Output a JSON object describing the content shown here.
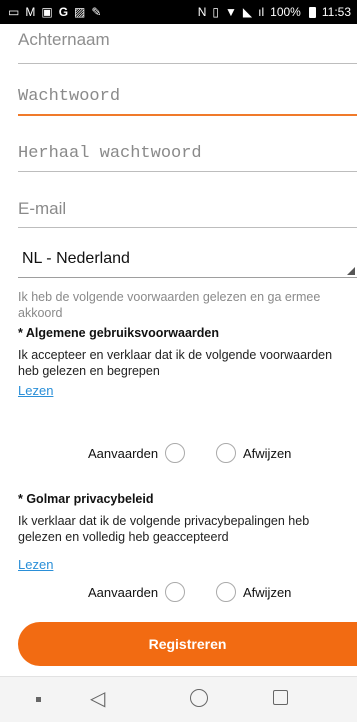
{
  "statusbar": {
    "battery": "100%",
    "time": "11:53",
    "icons": [
      "keyboard-icon",
      "gmail-icon",
      "calendar-icon",
      "google-icon",
      "photo-icon",
      "wrench-icon",
      "nfc-icon",
      "vibrate-icon",
      "wifi-icon",
      "signal-off-icon",
      "signal-icon",
      "battery-icon"
    ]
  },
  "form": {
    "achternaam_placeholder": "Achternaam",
    "wachtwoord_placeholder": "Wachtwoord",
    "herhaal_placeholder": "Herhaal wachtwoord",
    "email_placeholder": "E-mail",
    "country_value": "NL - Nederland"
  },
  "terms": {
    "intro": "Ik heb de volgende voorwaarden gelezen en ga ermee akkoord",
    "general": {
      "title": "* Algemene gebruiksvoorwaarden",
      "text": "Ik accepteer en verklaar dat ik de volgende voorwaarden heb gelezen en begrepen",
      "read_link": "Lezen",
      "accept": "Aanvaarden",
      "reject": "Afwijzen"
    },
    "privacy": {
      "title": "* Golmar privacybeleid",
      "text": "Ik verklaar dat ik de volgende privacybepalingen heb gelezen en volledig heb geaccepteerd",
      "read_link": "Lezen",
      "accept": "Aanvaarden",
      "reject": "Afwijzen"
    }
  },
  "register_button": "Registreren",
  "colors": {
    "accent": "#f26b12",
    "link": "#2a8fd8",
    "active_underline": "#f07a2a"
  },
  "navbar": {
    "icons": [
      "recent-dot-icon",
      "back-icon",
      "home-icon",
      "overview-icon"
    ]
  }
}
